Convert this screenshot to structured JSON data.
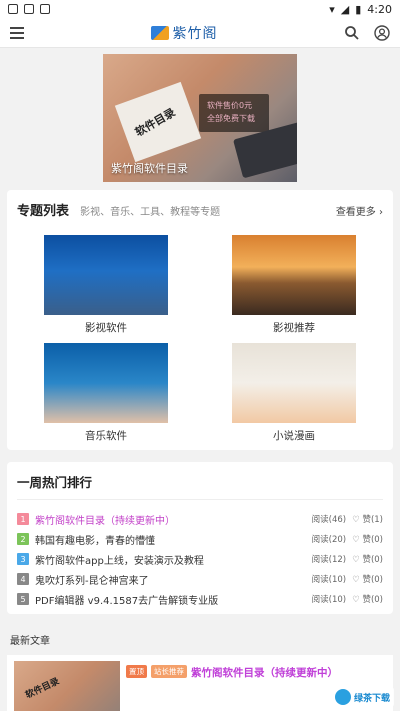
{
  "status_bar": {
    "time": "4:20"
  },
  "header": {
    "logo_text": "紫竹阁"
  },
  "banner": {
    "title": "紫竹阁软件目录",
    "stamp": "软件目录",
    "price_line1": "软件售价0元",
    "price_line2": "全部免费下载"
  },
  "topics": {
    "title": "专题列表",
    "subtitle": "影视、音乐、工具、教程等专题",
    "more": "查看更多",
    "items": [
      {
        "label": "影视软件"
      },
      {
        "label": "影视推荐"
      },
      {
        "label": "音乐软件"
      },
      {
        "label": "小说漫画"
      }
    ]
  },
  "hot": {
    "title": "一周热门排行",
    "read_label": "阅读",
    "like_label": "赞",
    "items": [
      {
        "rank": "1",
        "color": "#f48a9a",
        "text": "紫竹阁软件目录（持续更新中）",
        "reads": "(46)",
        "likes": "(1)",
        "highlight": true
      },
      {
        "rank": "2",
        "color": "#7cc45a",
        "text": "韩国有趣电影，青春的懵懂",
        "reads": "(20)",
        "likes": "(0)"
      },
      {
        "rank": "3",
        "color": "#4aa8e8",
        "text": "紫竹阁软件app上线，安装演示及教程",
        "reads": "(12)",
        "likes": "(0)"
      },
      {
        "rank": "4",
        "color": "#888888",
        "text": "鬼吹灯系列-昆仑神宫来了",
        "reads": "(10)",
        "likes": "(0)"
      },
      {
        "rank": "5",
        "color": "#888888",
        "text": "PDF编辑器 v9.4.1587去广告解锁专业版",
        "reads": "(10)",
        "likes": "(0)"
      }
    ]
  },
  "latest": {
    "title": "最新文章",
    "article": {
      "badge1": "置顶",
      "badge1_color": "#f07a4a",
      "badge2": "站长推荐",
      "badge2_color": "#f4a06a",
      "title": "紫竹阁软件目录（持续更新中）",
      "thumb_stamp": "软件目录"
    }
  },
  "watermark": {
    "text": "绿茶下载"
  }
}
